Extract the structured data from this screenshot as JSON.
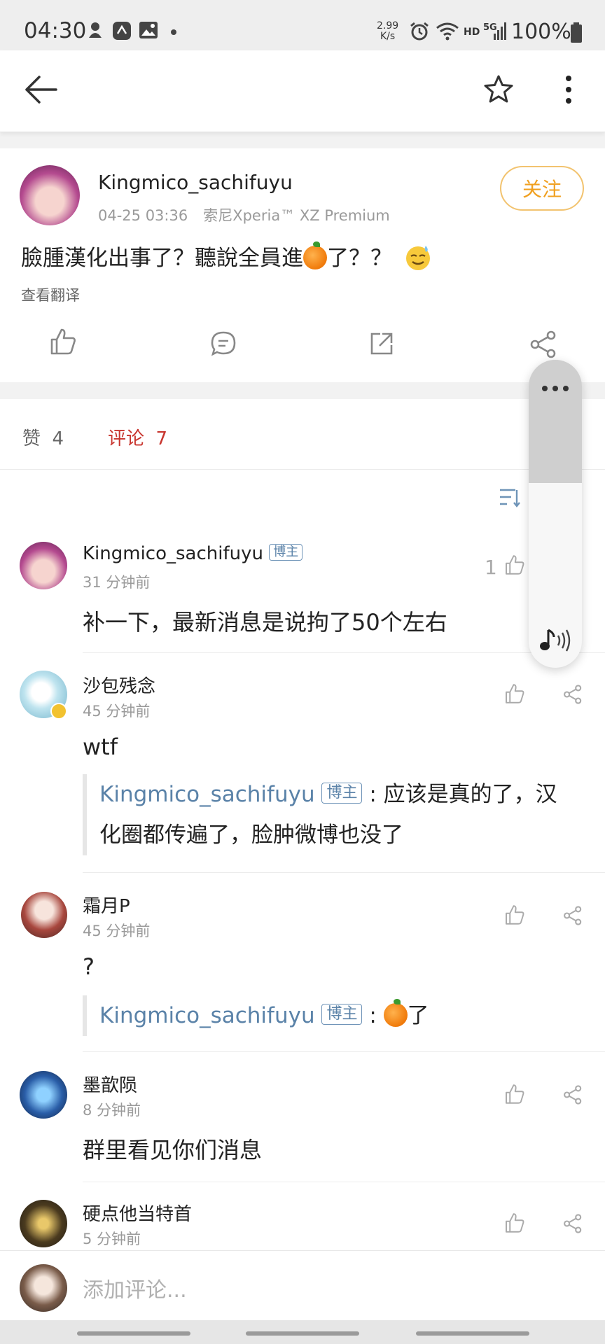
{
  "status_bar": {
    "time": "04:30",
    "net_speed_value": "2.99",
    "net_speed_unit": "K/s",
    "hd_label": "HD",
    "signal_label": "5G",
    "battery_text": "100%"
  },
  "post": {
    "author": "Kingmico_sachifuyu",
    "timestamp": "04-25 03:36",
    "device": "索尼Xperia™ XZ Premium",
    "follow_label": "关注",
    "text_before_emoji": "臉腫漢化出事了？聽說全員進",
    "text_after_emoji": "了？？",
    "translate_label": "查看翻译"
  },
  "tabs": {
    "likes_label": "赞",
    "likes_count": "4",
    "comments_label": "评论",
    "comments_count": "7",
    "accent_color": "#c8352e"
  },
  "comments": [
    {
      "author": "Kingmico_sachifuyu",
      "badge": "博主",
      "time": "31 分钟前",
      "text": "补一下，最新消息是说拘了50个左右",
      "like_count": "1"
    },
    {
      "author": "沙包残念",
      "time": "45 分钟前",
      "text": "wtf",
      "reply": {
        "author": "Kingmico_sachifuyu",
        "badge": "博主",
        "text": "应该是真的了，汉化圈都传遍了，脸肿微博也没了"
      }
    },
    {
      "author": "霜月P",
      "time": "45 分钟前",
      "text": "?",
      "reply": {
        "author": "Kingmico_sachifuyu",
        "badge": "博主",
        "text_after_emoji": "了"
      }
    },
    {
      "author": "墨歆陨",
      "time": "8 分钟前",
      "text": "群里看见你们消息"
    },
    {
      "author": "硬点他当特首",
      "time": "5 分钟前"
    }
  ],
  "bottom": {
    "comment_placeholder": "添加评论..."
  },
  "icons": [
    "back-arrow-icon",
    "star-icon",
    "more-vert-icon",
    "thumb-up-icon",
    "comment-icon",
    "external-share-icon",
    "share-icon",
    "more-horiz-icon",
    "music-sound-icon",
    "sort-icon"
  ]
}
